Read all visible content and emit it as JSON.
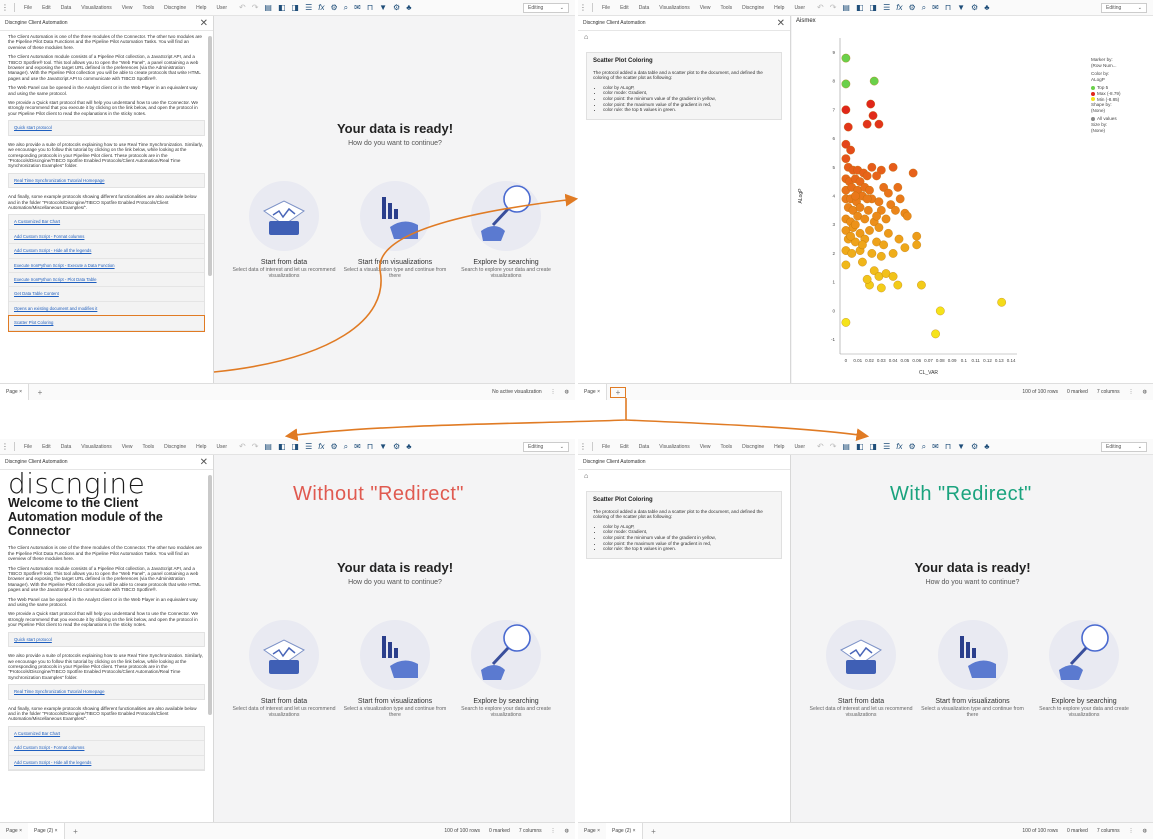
{
  "menu": {
    "items": [
      "File",
      "Edit",
      "Data",
      "Visualizations",
      "View",
      "Tools",
      "Discngine",
      "Help",
      "User"
    ],
    "mode": "Editing"
  },
  "panel": {
    "title": "Discngine Client Automation",
    "logo": "discngine",
    "welcome": "Welcome to the Client Automation module of the Connector",
    "p1": "The Client Automation is one of the three modules of the Connector. The other two modules are the Pipeline Pilot Data Functions and the Pipeline Pilot Automation Tasks. You will find an overview of these modules here.",
    "p2": "The Client Automation module consists of a Pipeline Pilot collection, a JavaScript API, and a TIBCO Spotfire® tool. This tool allows you to open the \"Web Panel\", a panel containing a web browser and exposing the target URL defined in the preferences (via the Administration Manager). With the Pipeline Pilot collection you will be able to create protocols that write HTML pages and use the JavaScript API to communicate with TIBCO Spotfire®.",
    "p3": "The Web Panel can be opened in the Analyst client or in the Web Player in an equivalent way and using the same protocol.",
    "p4": "We provide a Quick start protocol that will help you understand how to use the Connector. We strongly recommend that you execute it by clicking on the link below, and open the protocol in your Pipeline Pilot client to read the explanations in the sticky notes.",
    "quick_link": "Quick start protocol",
    "p5": "We also provide a suite of protocols explaining how to use Real Time Synchronization. Similarly, we encourage you to follow this tutorial by clicking on the link below, while looking at the corresponding protocols in your Pipeline Pilot client. These protocols are in the \"Protocols/Discngine/TIBCO Spotfire Enabled Protocols/Client Automation/Real Time Synchronization Examples\" folder.",
    "rts_link": "Real Time Synchronization Tutorial Homepage",
    "p6": "And finally, some example protocols showing different functionalities are also available below and in the folder \"Protocols/Discngine/TIBCO Spotfire Enabled Protocols/Client Automation/Miscellaneous Examples/\".",
    "examples": [
      "A Customized Bar Chart",
      "Add Custom Script - Format columns",
      "Add Custom Script - Hide all the legends",
      "Execute IronPython Script - Execute a Data Function",
      "Execute IronPython Script - Plot Data Table",
      "Get Data Table Content",
      "Opens an existing document and modifies it",
      "Scatter Plot Coloring"
    ]
  },
  "canvas": {
    "heading": "Your data is ready!",
    "sub": "How do you want to continue?",
    "cards": [
      {
        "title": "Start from data",
        "desc": "Select data of interest and let us recommend visualizations"
      },
      {
        "title": "Start from visualizations",
        "desc": "Select a visualization type and continue from there"
      },
      {
        "title": "Explore by searching",
        "desc": "Search to explore your data and create visualizations"
      }
    ]
  },
  "status": {
    "page": "Page",
    "page2": "Page (2)",
    "no_vis": "No active visualization",
    "rows": "100 of 100 rows",
    "marked": "0 marked",
    "columns": "7 columns"
  },
  "scatter_panel": {
    "title": "Scatter Plot Coloring",
    "desc": "The protocol added a data table and a scatter plot to the document, and defined the coloring of the scatter plot as following:",
    "bullets": [
      "color by ALogP,",
      "color mode: Gradient,",
      "color point: the minimum value of the gradient in yellow,",
      "color point: the maximum value of the gradient in red,",
      "color rule: the top 5 values in green."
    ]
  },
  "labels": {
    "without": "Without \"Redirect\"",
    "with": "With \"Redirect\"",
    "without_color": "#e05a50",
    "with_color": "#1aa37e"
  },
  "legend": {
    "marker_by": "Marker by:",
    "marker_val": "(Row Num...",
    "color_by": "Color by:",
    "color_val": "ALogP",
    "top": "Top 5",
    "max": "Max (-8.79)",
    "min": "Min (-8.85)",
    "shape_by": "Shape by:",
    "shape_val": "(None)",
    "all_values": "All values",
    "size_by": "Size by:",
    "size_val": "(None)"
  },
  "chart_data": {
    "type": "scatter",
    "title": "Aismex",
    "xlabel": "CL_VAR",
    "ylabel": "ALogP",
    "xlim": [
      -0.005,
      0.145
    ],
    "ylim": [
      -1.5,
      9.5
    ],
    "xticks": [
      "0",
      "0.01",
      "0.02",
      "0.03",
      "0.04",
      "0.05",
      "0.06",
      "0.07",
      "0.08",
      "0.09",
      "0.1",
      "0.11",
      "0.12",
      "0.13",
      "0.14"
    ],
    "yticks": [
      "-1",
      "0",
      "1",
      "2",
      "3",
      "4",
      "5",
      "6",
      "7",
      "8",
      "9"
    ],
    "colors": {
      "top": "#6ad04a",
      "max": "#e0261a",
      "min": "#f5e31a"
    },
    "points": [
      {
        "x": 0.0,
        "y": 8.8,
        "c": "top"
      },
      {
        "x": 0.0,
        "y": 7.9,
        "c": "top"
      },
      {
        "x": 0.024,
        "y": 8.0,
        "c": "top"
      },
      {
        "x": 0.0,
        "y": 7.0,
        "c": "max"
      },
      {
        "x": 0.021,
        "y": 7.2,
        "c": "max"
      },
      {
        "x": 0.023,
        "y": 6.8,
        "c": "max"
      },
      {
        "x": 0.002,
        "y": 6.4,
        "c": "max"
      },
      {
        "x": 0.018,
        "y": 6.5,
        "c": "max"
      },
      {
        "x": 0.028,
        "y": 6.5,
        "c": "max"
      },
      {
        "x": 0.0,
        "y": 5.8,
        "c": "max"
      },
      {
        "x": 0.004,
        "y": 5.6,
        "c": "max"
      },
      {
        "x": 0.0,
        "y": 5.3,
        "c": "max"
      },
      {
        "x": 0.002,
        "y": 5.0,
        "c": "max"
      },
      {
        "x": 0.006,
        "y": 4.9,
        "c": "max"
      },
      {
        "x": 0.01,
        "y": 4.9,
        "c": "max"
      },
      {
        "x": 0.015,
        "y": 4.8,
        "c": "max"
      },
      {
        "x": 0.022,
        "y": 5.0,
        "c": "max"
      },
      {
        "x": 0.03,
        "y": 4.9,
        "c": "max"
      },
      {
        "x": 0.0,
        "y": 4.6,
        "c": "max"
      },
      {
        "x": 0.003,
        "y": 4.5,
        "c": "max"
      },
      {
        "x": 0.008,
        "y": 4.6,
        "c": "max"
      },
      {
        "x": 0.012,
        "y": 4.5,
        "c": "max"
      },
      {
        "x": 0.018,
        "y": 4.7,
        "c": "max"
      },
      {
        "x": 0.026,
        "y": 4.7,
        "c": "max"
      },
      {
        "x": 0.04,
        "y": 5.0,
        "c": "max"
      },
      {
        "x": 0.057,
        "y": 4.8,
        "c": "max"
      },
      {
        "x": 0.0,
        "y": 4.2,
        "c": "max"
      },
      {
        "x": 0.005,
        "y": 4.3,
        "c": "max"
      },
      {
        "x": 0.01,
        "y": 4.2,
        "c": "max"
      },
      {
        "x": 0.016,
        "y": 4.3,
        "c": "max"
      },
      {
        "x": 0.02,
        "y": 4.2,
        "c": "max"
      },
      {
        "x": 0.032,
        "y": 4.3,
        "c": "max"
      },
      {
        "x": 0.036,
        "y": 4.1,
        "c": "max"
      },
      {
        "x": 0.044,
        "y": 4.3,
        "c": "max"
      },
      {
        "x": 0.0,
        "y": 3.9,
        "c": "max"
      },
      {
        "x": 0.004,
        "y": 3.9,
        "c": "max"
      },
      {
        "x": 0.009,
        "y": 3.8,
        "c": "max"
      },
      {
        "x": 0.014,
        "y": 4.0,
        "c": "max"
      },
      {
        "x": 0.022,
        "y": 3.9,
        "c": "max"
      },
      {
        "x": 0.028,
        "y": 3.8,
        "c": "max"
      },
      {
        "x": 0.038,
        "y": 3.7,
        "c": "max"
      },
      {
        "x": 0.046,
        "y": 3.9,
        "c": "max"
      },
      {
        "x": 0.002,
        "y": 3.6,
        "c": "max"
      },
      {
        "x": 0.006,
        "y": 3.5,
        "c": "max"
      },
      {
        "x": 0.012,
        "y": 3.6,
        "c": "max"
      },
      {
        "x": 0.019,
        "y": 3.5,
        "c": "max"
      },
      {
        "x": 0.03,
        "y": 3.5,
        "c": "max"
      },
      {
        "x": 0.042,
        "y": 3.5,
        "c": "max"
      },
      {
        "x": 0.05,
        "y": 3.4,
        "c": "max"
      },
      {
        "x": 0.052,
        "y": 3.3,
        "c": "max"
      },
      {
        "x": 0.0,
        "y": 3.2,
        "c": "max"
      },
      {
        "x": 0.004,
        "y": 3.1,
        "c": "max"
      },
      {
        "x": 0.01,
        "y": 3.3,
        "c": "max"
      },
      {
        "x": 0.016,
        "y": 3.2,
        "c": "max"
      },
      {
        "x": 0.024,
        "y": 3.1,
        "c": "max"
      },
      {
        "x": 0.034,
        "y": 3.2,
        "c": "max"
      },
      {
        "x": 0.0,
        "y": 2.8,
        "c": "min"
      },
      {
        "x": 0.006,
        "y": 2.9,
        "c": "min"
      },
      {
        "x": 0.012,
        "y": 2.7,
        "c": "min"
      },
      {
        "x": 0.02,
        "y": 2.8,
        "c": "min"
      },
      {
        "x": 0.028,
        "y": 2.9,
        "c": "min"
      },
      {
        "x": 0.036,
        "y": 2.7,
        "c": "min"
      },
      {
        "x": 0.002,
        "y": 2.5,
        "c": "min"
      },
      {
        "x": 0.008,
        "y": 2.4,
        "c": "min"
      },
      {
        "x": 0.016,
        "y": 2.5,
        "c": "min"
      },
      {
        "x": 0.026,
        "y": 2.4,
        "c": "min"
      },
      {
        "x": 0.045,
        "y": 2.5,
        "c": "min"
      },
      {
        "x": 0.05,
        "y": 2.2,
        "c": "min"
      },
      {
        "x": 0.06,
        "y": 2.6,
        "c": "min"
      },
      {
        "x": 0.06,
        "y": 2.3,
        "c": "min"
      },
      {
        "x": 0.0,
        "y": 2.1,
        "c": "min"
      },
      {
        "x": 0.005,
        "y": 2.0,
        "c": "min"
      },
      {
        "x": 0.012,
        "y": 2.1,
        "c": "min"
      },
      {
        "x": 0.022,
        "y": 2.0,
        "c": "min"
      },
      {
        "x": 0.03,
        "y": 1.9,
        "c": "min"
      },
      {
        "x": 0.04,
        "y": 2.0,
        "c": "min"
      },
      {
        "x": 0.0,
        "y": 1.6,
        "c": "min"
      },
      {
        "x": 0.014,
        "y": 1.7,
        "c": "min"
      },
      {
        "x": 0.024,
        "y": 1.4,
        "c": "min"
      },
      {
        "x": 0.028,
        "y": 1.2,
        "c": "min"
      },
      {
        "x": 0.034,
        "y": 1.3,
        "c": "min"
      },
      {
        "x": 0.04,
        "y": 1.2,
        "c": "min"
      },
      {
        "x": 0.02,
        "y": 0.9,
        "c": "min"
      },
      {
        "x": 0.03,
        "y": 0.8,
        "c": "min"
      },
      {
        "x": 0.044,
        "y": 0.9,
        "c": "min"
      },
      {
        "x": 0.064,
        "y": 0.9,
        "c": "min"
      },
      {
        "x": 0.08,
        "y": 0.0,
        "c": "min"
      },
      {
        "x": 0.132,
        "y": 0.3,
        "c": "min"
      },
      {
        "x": 0.0,
        "y": -0.4,
        "c": "min"
      },
      {
        "x": 0.076,
        "y": -0.8,
        "c": "min"
      },
      {
        "x": 0.008,
        "y": 4.0,
        "c": "max"
      },
      {
        "x": 0.018,
        "y": 3.9,
        "c": "max"
      },
      {
        "x": 0.026,
        "y": 3.3,
        "c": "max"
      },
      {
        "x": 0.004,
        "y": 2.6,
        "c": "min"
      },
      {
        "x": 0.014,
        "y": 2.3,
        "c": "min"
      },
      {
        "x": 0.018,
        "y": 1.1,
        "c": "min"
      },
      {
        "x": 0.032,
        "y": 2.3,
        "c": "min"
      },
      {
        "x": 0.008,
        "y": 3.0,
        "c": "min"
      }
    ]
  }
}
